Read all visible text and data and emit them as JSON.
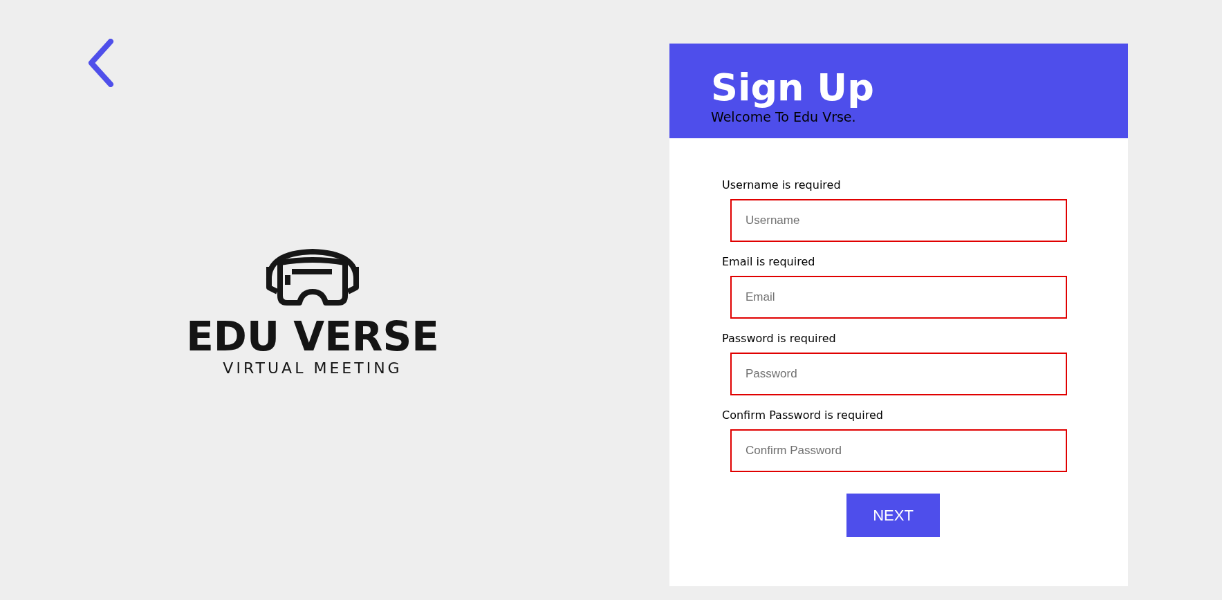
{
  "logo": {
    "name": "EDU VERSE",
    "tagline": "VIRTUAL MEETING"
  },
  "header": {
    "title": "Sign Up",
    "subtitle": "Welcome To Edu Vrse."
  },
  "fields": [
    {
      "error": "Username is required",
      "placeholder": "Username",
      "invalid": true
    },
    {
      "error": "Email is required",
      "placeholder": "Email",
      "invalid": true
    },
    {
      "error": "Password is required",
      "placeholder": "Password",
      "invalid": true
    },
    {
      "error": "Confirm Password is required",
      "placeholder": "Confirm Password",
      "invalid": true
    }
  ],
  "submit": {
    "label": "NEXT"
  }
}
